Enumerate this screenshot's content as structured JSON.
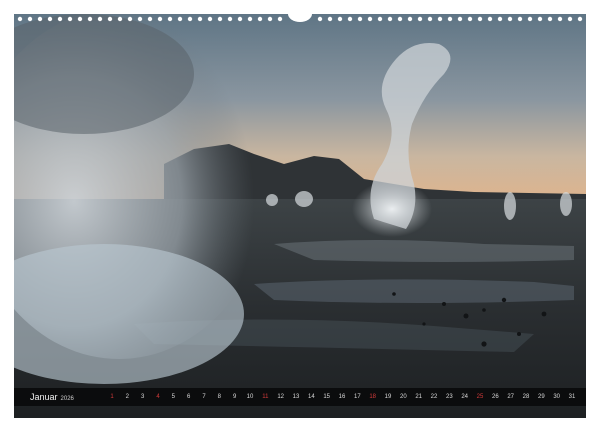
{
  "calendar": {
    "month": "Januar",
    "year": "2026",
    "days": [
      "1",
      "2",
      "3",
      "4",
      "5",
      "6",
      "7",
      "8",
      "9",
      "10",
      "11",
      "12",
      "13",
      "14",
      "15",
      "16",
      "17",
      "18",
      "19",
      "20",
      "21",
      "22",
      "23",
      "24",
      "25",
      "26",
      "27",
      "28",
      "29",
      "30",
      "31"
    ],
    "highlighted_days": [
      "1",
      "4",
      "11",
      "18",
      "25"
    ]
  },
  "colors": {
    "strip_background": "#0b0c0d",
    "day_text": "#d9d9d9",
    "highlight_text": "#d23a3a"
  },
  "photo": {
    "subject": "geyser-field-at-dawn"
  }
}
